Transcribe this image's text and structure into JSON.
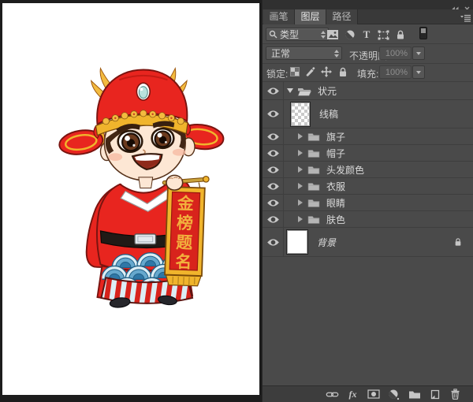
{
  "tabs": {
    "items": [
      {
        "label": "画笔",
        "active": false
      },
      {
        "label": "图层",
        "active": true
      },
      {
        "label": "路径",
        "active": false
      }
    ]
  },
  "filter": {
    "type_label": "类型",
    "type_glyph": "T",
    "kind_icons": [
      "pixel-filter",
      "adjustment-filter",
      "type-filter",
      "shape-filter",
      "smart-object-filter"
    ],
    "toggle_state": "on"
  },
  "blend": {
    "mode": "正常",
    "opacity_label": "不透明度:",
    "opacity_value": "100%"
  },
  "lock": {
    "label": "锁定:",
    "icons": [
      "lock-transparency",
      "lock-pixels",
      "lock-position",
      "lock-all"
    ],
    "fill_label": "填充:",
    "fill_value": "100%"
  },
  "layers": {
    "rows": [
      {
        "name": "状元",
        "type": "group-open",
        "visible": true
      },
      {
        "name": "线稿",
        "type": "layer-transparent-thumb",
        "visible": true
      },
      {
        "name": "旗子",
        "type": "group-closed",
        "visible": true
      },
      {
        "name": "帽子",
        "type": "group-closed",
        "visible": true
      },
      {
        "name": "头发颜色",
        "type": "group-closed",
        "visible": true
      },
      {
        "name": "衣服",
        "type": "group-closed",
        "visible": true
      },
      {
        "name": "眼睛",
        "type": "group-closed",
        "visible": true
      },
      {
        "name": "肤色",
        "type": "group-closed",
        "visible": true
      },
      {
        "name": "背景",
        "type": "background-layer",
        "visible": true,
        "locked": true
      }
    ]
  },
  "bottom_bar": {
    "fx_glyph": "fx",
    "icons": [
      "link-layers",
      "layer-style",
      "add-mask",
      "adjustment-layer",
      "new-group",
      "new-layer",
      "delete-layer"
    ]
  },
  "canvas": {
    "banner_text": "金榜题名",
    "banner_chars": [
      "金",
      "榜",
      "题",
      "名"
    ]
  },
  "colors": {
    "red": "#e8251f",
    "gold": "#f0b42c",
    "panel_bg": "#4a4a4a",
    "canvas_bg": "#ffffff"
  }
}
